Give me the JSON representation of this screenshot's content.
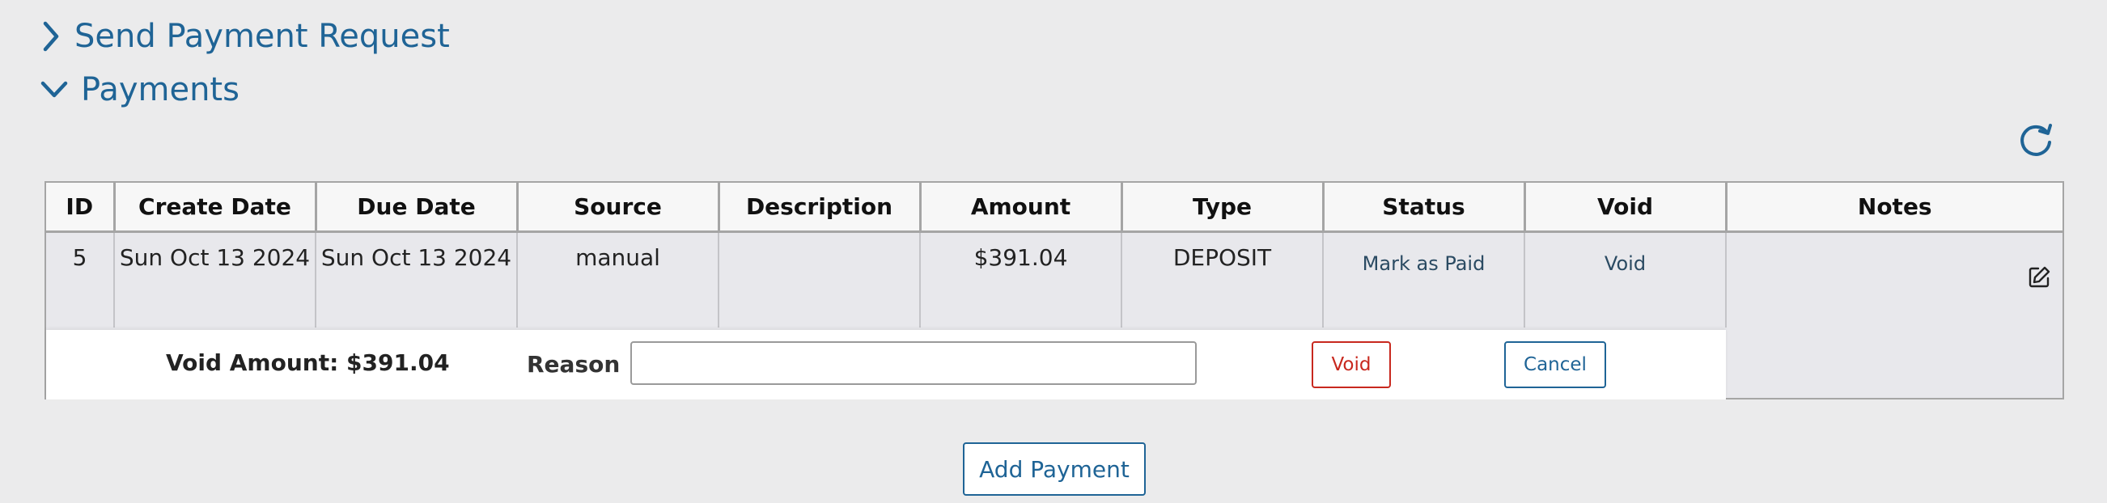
{
  "sections": {
    "send_payment_request": "Send Payment Request",
    "payments": "Payments"
  },
  "table": {
    "headers": [
      "ID",
      "Create Date",
      "Due Date",
      "Source",
      "Description",
      "Amount",
      "Type",
      "Status",
      "Void",
      "Notes"
    ],
    "rows": [
      {
        "id": "5",
        "create_date": "Sun Oct 13 2024",
        "due_date": "Sun Oct 13 2024",
        "source": "manual",
        "description": "",
        "amount": "$391.04",
        "type": "DEPOSIT",
        "status_action": "Mark as Paid",
        "void_action": "Void",
        "notes": ""
      }
    ]
  },
  "void_form": {
    "amount_label": "Void Amount: $391.04",
    "reason_label": "Reason",
    "reason_value": "",
    "void_button": "Void",
    "cancel_button": "Cancel"
  },
  "add_payment_button": "Add Payment",
  "icons": {
    "expand": "chevron-right-icon",
    "collapse": "chevron-down-icon",
    "refresh": "refresh-icon",
    "notes_edit": "edit-icon"
  },
  "colors": {
    "accent": "#1f6496",
    "danger": "#c8281e",
    "background": "#ebebec"
  }
}
